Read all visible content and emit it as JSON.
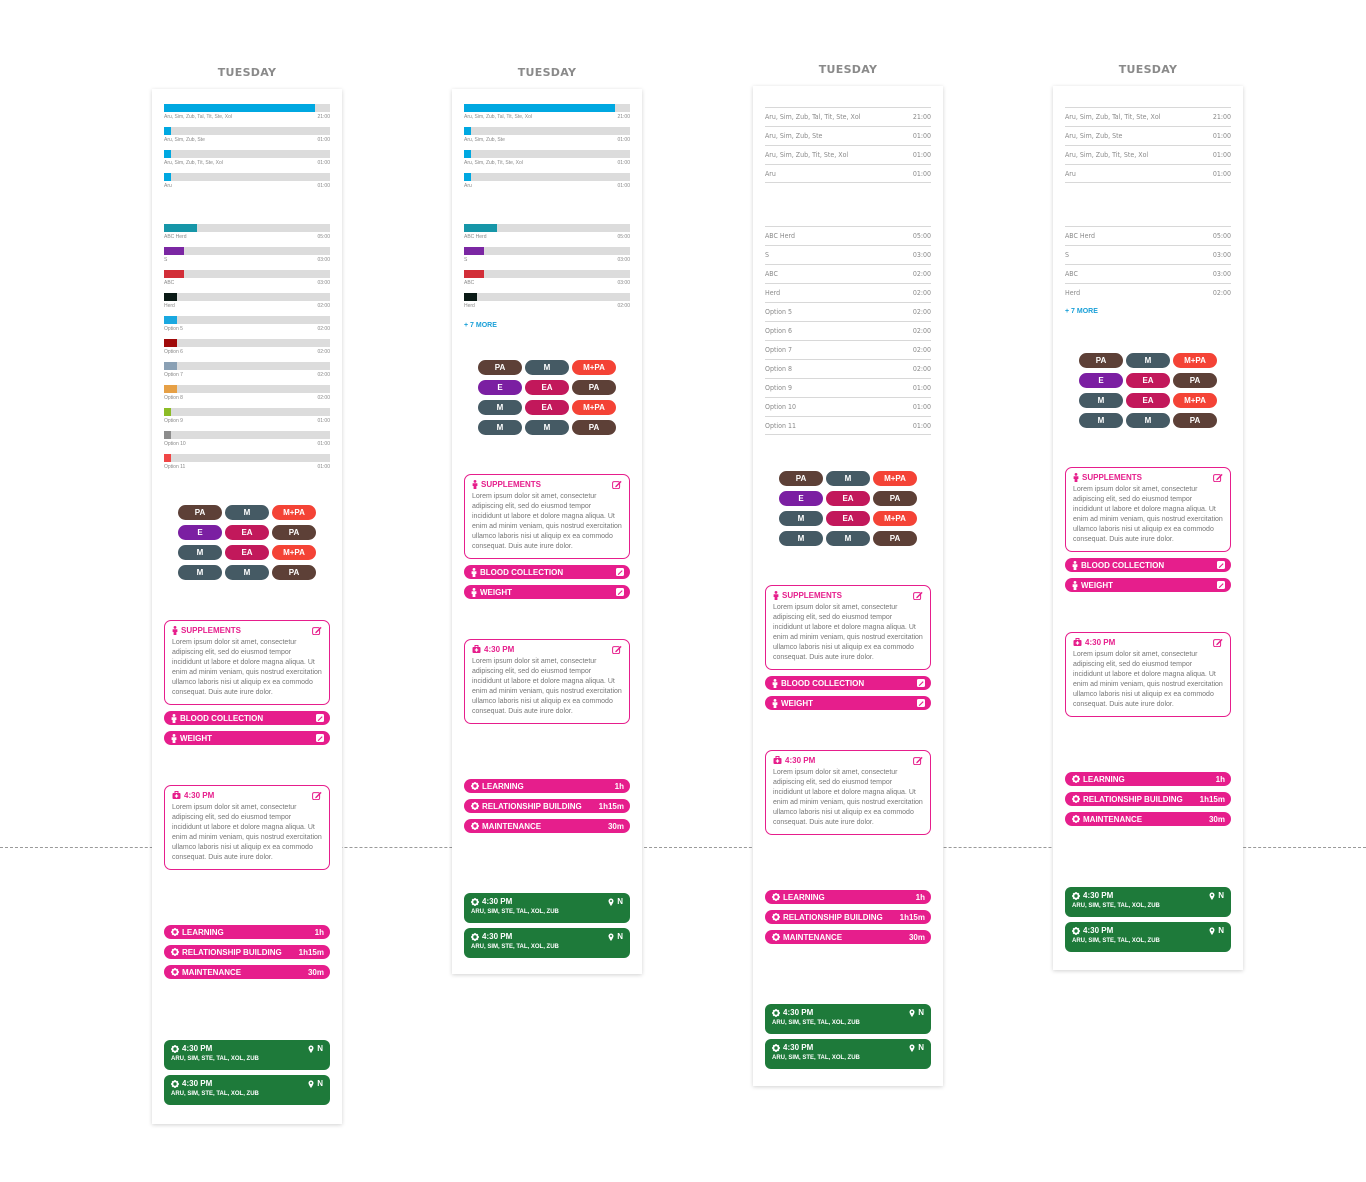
{
  "colors": {
    "accent_pink": "#e61e8c",
    "accent_blue": "#1aa0d8",
    "green": "#1e7a3a",
    "track": "#dcdcdc"
  },
  "columns": [
    {
      "day": "TUESDAY",
      "view": "bars",
      "group1": [
        {
          "label": "Aru, Sim, Zub, Tal, Tit, Ste, Xol",
          "time": "21:00",
          "fraction": 0.91,
          "color": "#00a8e1"
        },
        {
          "label": "Aru, Sim, Zub, Ste",
          "time": "01:00",
          "fraction": 0.04,
          "color": "#00a8e1"
        },
        {
          "label": "Aru, Sim, Zub, Tit, Ste, Xol",
          "time": "01:00",
          "fraction": 0.04,
          "color": "#00a8e1"
        },
        {
          "label": "Aru",
          "time": "01:00",
          "fraction": 0.04,
          "color": "#00a8e1"
        }
      ],
      "group2": [
        {
          "label": "ABC Herd",
          "time": "05:00",
          "fraction": 0.2,
          "color": "#1696a8"
        },
        {
          "label": "S",
          "time": "03:00",
          "fraction": 0.12,
          "color": "#7b27a3"
        },
        {
          "label": "ABC",
          "time": "03:00",
          "fraction": 0.12,
          "color": "#d22e38"
        },
        {
          "label": "Herd",
          "time": "02:00",
          "fraction": 0.08,
          "color": "#0a1a16"
        },
        {
          "label": "Option 5",
          "time": "02:00",
          "fraction": 0.08,
          "color": "#1aa8e0"
        },
        {
          "label": "Option 6",
          "time": "02:00",
          "fraction": 0.08,
          "color": "#a00a0a"
        },
        {
          "label": "Option 7",
          "time": "02:00",
          "fraction": 0.08,
          "color": "#8aa0b4"
        },
        {
          "label": "Option 8",
          "time": "02:00",
          "fraction": 0.08,
          "color": "#e6a046"
        },
        {
          "label": "Option 9",
          "time": "01:00",
          "fraction": 0.04,
          "color": "#8cbc26"
        },
        {
          "label": "Option 10",
          "time": "01:00",
          "fraction": 0.04,
          "color": "#8c8c8c"
        },
        {
          "label": "Option 11",
          "time": "01:00",
          "fraction": 0.04,
          "color": "#f04646"
        }
      ],
      "more": null
    },
    {
      "day": "TUESDAY",
      "view": "bars",
      "group1": [
        {
          "label": "Aru, Sim, Zub, Tal, Tit, Ste, Xol",
          "time": "21:00",
          "fraction": 0.91,
          "color": "#00a8e1"
        },
        {
          "label": "Aru, Sim, Zub, Ste",
          "time": "01:00",
          "fraction": 0.04,
          "color": "#00a8e1"
        },
        {
          "label": "Aru, Sim, Zub, Tit, Ste, Xol",
          "time": "01:00",
          "fraction": 0.04,
          "color": "#00a8e1"
        },
        {
          "label": "Aru",
          "time": "01:00",
          "fraction": 0.04,
          "color": "#00a8e1"
        }
      ],
      "group2": [
        {
          "label": "ABC Herd",
          "time": "05:00",
          "fraction": 0.2,
          "color": "#1696a8"
        },
        {
          "label": "S",
          "time": "03:00",
          "fraction": 0.12,
          "color": "#7b27a3"
        },
        {
          "label": "ABC",
          "time": "03:00",
          "fraction": 0.12,
          "color": "#d22e38"
        },
        {
          "label": "Herd",
          "time": "02:00",
          "fraction": 0.08,
          "color": "#0a1a16"
        }
      ],
      "more": "+ 7 MORE"
    },
    {
      "day": "TUESDAY",
      "view": "list",
      "group1": [
        {
          "label": "Aru, Sim, Zub, Tal, Tit, Ste, Xol",
          "time": "21:00"
        },
        {
          "label": "Aru, Sim, Zub, Ste",
          "time": "01:00"
        },
        {
          "label": "Aru, Sim, Zub, Tit, Ste, Xol",
          "time": "01:00"
        },
        {
          "label": "Aru",
          "time": "01:00"
        }
      ],
      "group2": [
        {
          "label": "ABC Herd",
          "time": "05:00"
        },
        {
          "label": "S",
          "time": "03:00"
        },
        {
          "label": "ABC",
          "time": "02:00"
        },
        {
          "label": "Herd",
          "time": "02:00"
        },
        {
          "label": "Option 5",
          "time": "02:00"
        },
        {
          "label": "Option 6",
          "time": "02:00"
        },
        {
          "label": "Option 7",
          "time": "02:00"
        },
        {
          "label": "Option 8",
          "time": "02:00"
        },
        {
          "label": "Option 9",
          "time": "01:00"
        },
        {
          "label": "Option 10",
          "time": "01:00"
        },
        {
          "label": "Option 11",
          "time": "01:00"
        }
      ],
      "more": null
    },
    {
      "day": "TUESDAY",
      "view": "list",
      "group1": [
        {
          "label": "Aru, Sim, Zub, Tal, Tit, Ste, Xol",
          "time": "21:00"
        },
        {
          "label": "Aru, Sim, Zub, Ste",
          "time": "01:00"
        },
        {
          "label": "Aru, Sim, Zub, Tit, Ste, Xol",
          "time": "01:00"
        },
        {
          "label": "Aru",
          "time": "01:00"
        }
      ],
      "group2": [
        {
          "label": "ABC Herd",
          "time": "05:00"
        },
        {
          "label": "S",
          "time": "03:00"
        },
        {
          "label": "ABC",
          "time": "03:00"
        },
        {
          "label": "Herd",
          "time": "02:00"
        }
      ],
      "more": "+ 7 MORE"
    }
  ],
  "pills": [
    {
      "label": "PA",
      "color": "#5d4037"
    },
    {
      "label": "M",
      "color": "#455a64"
    },
    {
      "label": "M+PA",
      "color": "#f44336"
    },
    {
      "label": "E",
      "color": "#7b1fa2"
    },
    {
      "label": "EA",
      "color": "#c2185b"
    },
    {
      "label": "PA",
      "color": "#5d4037"
    },
    {
      "label": "M",
      "color": "#455a64"
    },
    {
      "label": "EA",
      "color": "#c2185b"
    },
    {
      "label": "M+PA",
      "color": "#f44336"
    },
    {
      "label": "M",
      "color": "#455a64"
    },
    {
      "label": "M",
      "color": "#455a64"
    },
    {
      "label": "PA",
      "color": "#5d4037"
    }
  ],
  "supplements": {
    "title": "SUPPLEMENTS",
    "icon": "person-icon",
    "body": "Lorem ipsum dolor sit amet, consectetur adipiscing elit, sed do eiusmod tempor incididunt ut labore et dolore magna aliqua. Ut enim ad minim veniam, quis nostrud exercitation ullamco laboris nisi ut aliquip ex ea commodo consequat. Duis aute irure dolor."
  },
  "tasks": [
    {
      "label": "BLOOD COLLECTION",
      "icon": "person-icon"
    },
    {
      "label": "WEIGHT",
      "icon": "person-icon"
    }
  ],
  "appointment": {
    "title": "4:30 PM",
    "icon": "medical-kit-icon",
    "body": "Lorem ipsum dolor sit amet, consectetur adipiscing elit, sed do eiusmod tempor incididunt ut labore et dolore magna aliqua. Ut enim ad minim veniam, quis nostrud exercitation ullamco laboris nisi ut aliquip ex ea commodo consequat. Duis aute irure dolor."
  },
  "activities": [
    {
      "label": "LEARNING",
      "duration": "1h"
    },
    {
      "label": "RELATIONSHIP BUILDING",
      "duration": "1h15m"
    },
    {
      "label": "MAINTENANCE",
      "duration": "30m"
    }
  ],
  "events": [
    {
      "time": "4:30 PM",
      "location": "N",
      "names": "ARU, SIM, STE, TAL, XOL, ZUB"
    },
    {
      "time": "4:30 PM",
      "location": "N",
      "names": "ARU, SIM, STE, TAL, XOL, ZUB"
    }
  ]
}
